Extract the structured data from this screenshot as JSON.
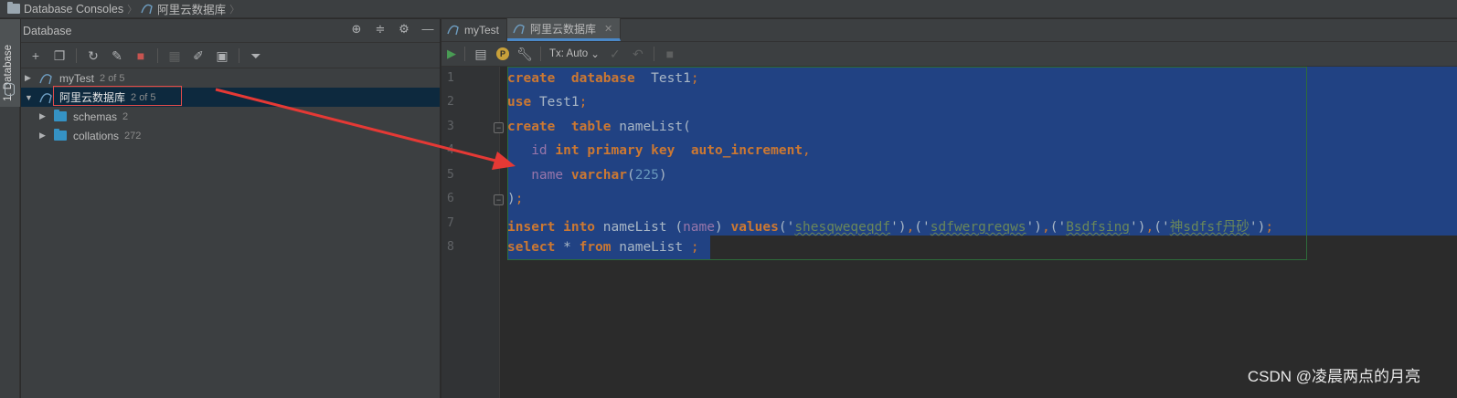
{
  "breadcrumb": {
    "root": "Database Consoles",
    "current": "阿里云数据库"
  },
  "tool_strip": {
    "tab_label": "1: Database"
  },
  "db_panel": {
    "title": "Database",
    "tree": [
      {
        "label": "myTest",
        "count": "2 of 5",
        "expanded": false
      },
      {
        "label": "阿里云数据库",
        "count": "2 of 5",
        "expanded": true,
        "selected": true
      },
      {
        "label": "schemas",
        "count": "2"
      },
      {
        "label": "collations",
        "count": "272"
      }
    ]
  },
  "editor": {
    "tabs": [
      {
        "label": "myTest",
        "active": false
      },
      {
        "label": "阿里云数据库",
        "active": true
      }
    ],
    "tx_mode": "Tx: Auto",
    "line_numbers": [
      "1",
      "2",
      "3",
      "4",
      "5",
      "6",
      "7",
      "8"
    ]
  },
  "code": {
    "l1_kw1": "create",
    "l1_kw2": "database",
    "l1_name": "Test1",
    "l2_kw": "use",
    "l2_name": "Test1",
    "l3_kw1": "create",
    "l3_kw2": "table",
    "l3_name": "nameList",
    "l4_col": "id",
    "l4_type": "int primary key",
    "l4_extra": "auto_increment",
    "l5_col": "name",
    "l5_type": "varchar",
    "l5_num": "225",
    "l7_kw1": "insert into",
    "l7_table": "nameList",
    "l7_col": "name",
    "l7_kw2": "values",
    "l7_v1": "shesqweqeqdf",
    "l7_v2": "sdfwergreqws",
    "l7_v3": "Bsdfsing",
    "l7_v4": "神sdfsf丹砂",
    "l8_kw1": "select",
    "l8_kw2": "from",
    "l8_table": "nameList"
  },
  "watermark": "CSDN @凌晨两点的月亮",
  "colors": {
    "keyword": "#cc7832",
    "identifier": "#9876aa",
    "string": "#6a8759",
    "number": "#6897bb",
    "selection": "#214283",
    "annotation_red": "#e04b4b"
  }
}
